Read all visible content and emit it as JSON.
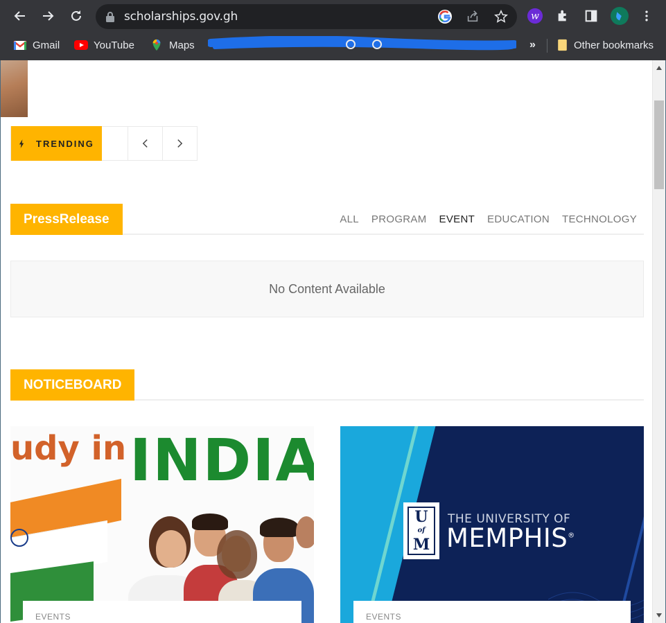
{
  "browser": {
    "url": "scholarships.gov.gh",
    "bookmarks": [
      {
        "label": "Gmail",
        "icon": "gmail-icon"
      },
      {
        "label": "YouTube",
        "icon": "youtube-icon"
      },
      {
        "label": "Maps",
        "icon": "maps-icon"
      }
    ],
    "bookmarks_overflow": "»",
    "other_bookmarks": "Other bookmarks"
  },
  "trending": {
    "label": "TRENDING"
  },
  "press_release": {
    "title": "PressRelease",
    "filters": [
      "ALL",
      "PROGRAM",
      "EVENT",
      "EDUCATION",
      "TECHNOLOGY"
    ],
    "active_filter": "EVENT",
    "empty_message": "No Content Available"
  },
  "noticeboard": {
    "title": "NOTICEBOARD",
    "cards": [
      {
        "category": "EVENTS",
        "image_text_1": "udy in",
        "image_text_2": "INDIA"
      },
      {
        "category": "EVENTS",
        "logo_letters": [
          "U",
          "of",
          "M"
        ],
        "image_text_1": "THE UNIVERSITY OF",
        "image_text_2": "MEMPHIS",
        "image_text_3": "®"
      }
    ]
  },
  "colors": {
    "accent": "#ffb400",
    "chrome": "#35363a"
  }
}
